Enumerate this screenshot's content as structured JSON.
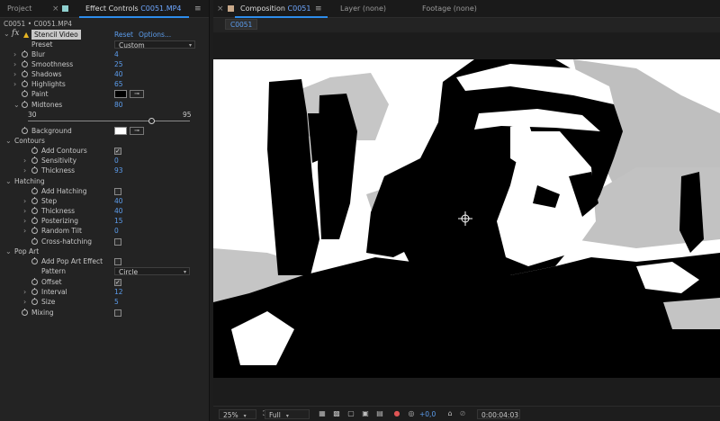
{
  "left_panel": {
    "tabs": {
      "project": "Project",
      "effect_controls_prefix": "Effect Controls",
      "effect_controls_file": "C0051.MP4"
    },
    "breadcrumb": "C0051 • C0051.MP4",
    "effect": {
      "name": "Stencil Video",
      "reset": "Reset",
      "options": "Options..."
    },
    "params": {
      "preset": {
        "label": "Preset",
        "value": "Custom"
      },
      "blur": {
        "label": "Blur",
        "value": "4"
      },
      "smoothness": {
        "label": "Smoothness",
        "value": "25"
      },
      "shadows": {
        "label": "Shadows",
        "value": "40"
      },
      "highlights": {
        "label": "Highlights",
        "value": "65"
      },
      "paint": {
        "label": "Paint",
        "color": "#000000"
      },
      "midtones": {
        "label": "Midtones",
        "value": "80",
        "range_min": "30",
        "range_max": "95"
      },
      "background": {
        "label": "Background",
        "color": "#ffffff"
      },
      "contours": {
        "label": "Contours"
      },
      "add_contours": {
        "label": "Add Contours",
        "checked": true
      },
      "sensitivity": {
        "label": "Sensitivity",
        "value": "0"
      },
      "contour_thickness": {
        "label": "Thickness",
        "value": "93"
      },
      "hatching": {
        "label": "Hatching"
      },
      "add_hatching": {
        "label": "Add Hatching",
        "checked": false
      },
      "step": {
        "label": "Step",
        "value": "40"
      },
      "hatch_thickness": {
        "label": "Thickness",
        "value": "40"
      },
      "posterizing": {
        "label": "Posterizing",
        "value": "15"
      },
      "random_tilt": {
        "label": "Random Tilt",
        "value": "0"
      },
      "cross_hatching": {
        "label": "Cross-hatching",
        "checked": false
      },
      "pop_art": {
        "label": "Pop Art"
      },
      "add_pop_art": {
        "label": "Add Pop Art Effect",
        "checked": false
      },
      "pattern": {
        "label": "Pattern",
        "value": "Circle"
      },
      "offset": {
        "label": "Offset",
        "checked": true
      },
      "interval": {
        "label": "Interval",
        "value": "12"
      },
      "size": {
        "label": "Size",
        "value": "5"
      },
      "mixing": {
        "label": "Mixing",
        "checked": false
      }
    }
  },
  "right_panel": {
    "tabs": {
      "composition_prefix": "Composition",
      "composition_name": "C0051",
      "layer": "Layer (none)",
      "footage": "Footage (none)"
    },
    "comp_chip": "C0051",
    "bottom_bar": {
      "zoom": "25%",
      "resolution": "Full",
      "exposure": "+0,0",
      "timecode": "0:00:04:03"
    }
  },
  "colors": {
    "accent_blue": "#5c9ded",
    "tab_underline": "#2d8ceb",
    "panel_bg": "#232323"
  }
}
